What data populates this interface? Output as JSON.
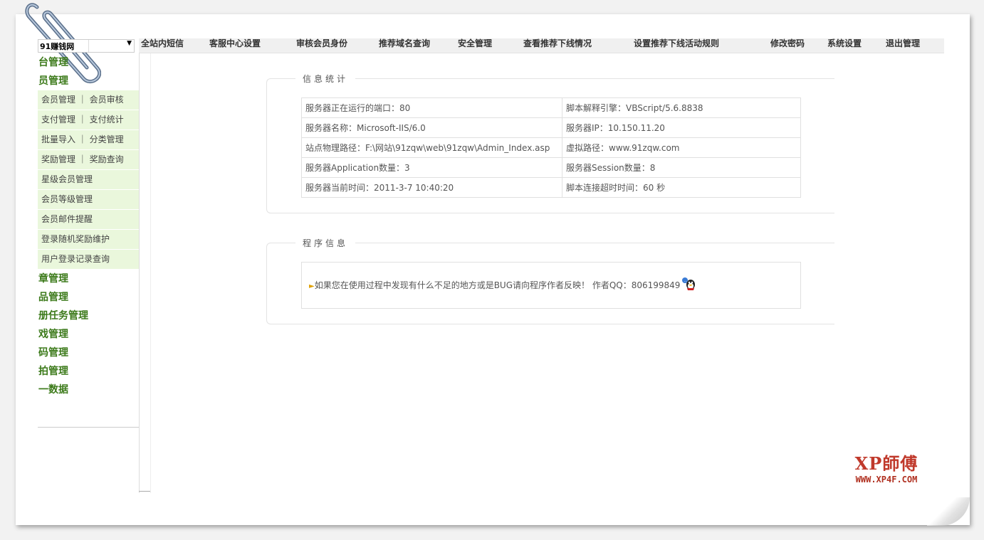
{
  "site_select": {
    "value": "91赚钱网"
  },
  "topnav": [
    "全站内短信",
    "客服中心设置",
    "审核会员身份",
    "推荐域名查询",
    "安全管理",
    "查看推荐下线情况",
    "设置推荐下线活动规则",
    "修改密码",
    "系统设置",
    "退出管理"
  ],
  "sidebar": {
    "cats_top": [
      "台管理",
      "员管理"
    ],
    "subs": [
      "会员管理 ｜ 会员审核",
      "支付管理 ｜ 支付统计",
      "批量导入 ｜ 分类管理",
      "奖励管理 ｜ 奖励查询",
      "星级会员管理",
      "会员等级管理",
      "会员邮件提醒",
      "登录随机奖励维护",
      "用户登录记录查询"
    ],
    "cats_bottom": [
      "章管理",
      "品管理",
      "册任务管理",
      "戏管理",
      "码管理",
      "拍管理",
      "一数据"
    ]
  },
  "info": {
    "legend": "信息统计",
    "rows": [
      [
        "服务器正在运行的端口：80",
        "脚本解释引擎：VBScript/5.6.8838"
      ],
      [
        "服务器名称：Microsoft-IIS/6.0",
        "服务器IP：10.150.11.20"
      ],
      [
        "站点物理路径：F:\\网站\\91zqw\\web\\91zqw\\Admin_Index.asp",
        "虚拟路径：www.91zqw.com"
      ],
      [
        "服务器Application数量：3",
        "服务器Session数量：8"
      ],
      [
        "服务器当前时间：2011-3-7 10:40:20",
        "脚本连接超时时间：60 秒"
      ]
    ]
  },
  "program": {
    "legend": "程序信息",
    "message": "如果您在使用过程中发现有什么不足的地方或是BUG请向程序作者反映！ 作者QQ：806199849"
  },
  "watermark": {
    "title": "XP師傅",
    "url": "WWW.XP4F.COM"
  },
  "colors": {
    "accent_green": "#3c7a1a",
    "submenu_bg": "#eaf7dc",
    "watermark_red": "#c0392b"
  }
}
